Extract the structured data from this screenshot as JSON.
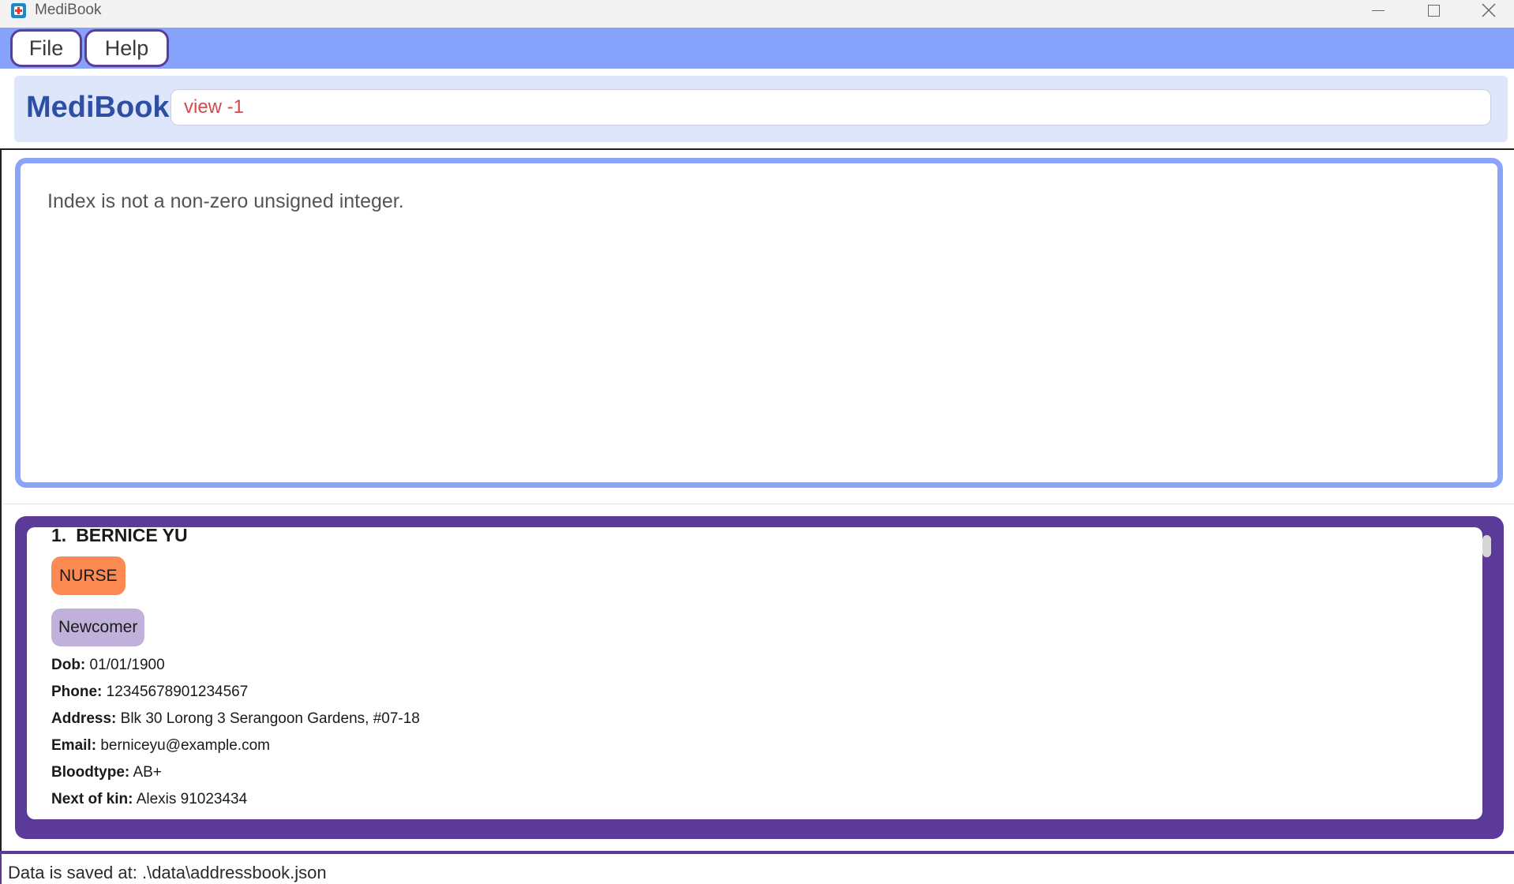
{
  "window": {
    "title": "MediBook",
    "icon": "medibook-app-icon",
    "controls": [
      "minimize-icon",
      "maximize-icon",
      "close-icon"
    ]
  },
  "menubar": {
    "file_label": "File",
    "help_label": "Help"
  },
  "command": {
    "brand": "MediBook",
    "input_value": "view -1"
  },
  "result": {
    "message": "Index is not a non-zero unsigned integer."
  },
  "person_list": {
    "items": [
      {
        "index": "1.",
        "name": "BERNICE YU",
        "role": "NURSE",
        "tag": "Newcomer",
        "dob_label": "Dob:",
        "dob": "01/01/1900",
        "phone_label": "Phone:",
        "phone": "12345678901234567",
        "address_label": "Address:",
        "address": "Blk 30 Lorong 3 Serangoon Gardens, #07-18",
        "email_label": "Email:",
        "email": "berniceyu@example.com",
        "bloodtype_label": "Bloodtype:",
        "bloodtype": "AB+",
        "kin_label": "Next of kin:",
        "kin": "Alexis 91023434"
      }
    ]
  },
  "statusbar": {
    "text": "Data is saved at: .\\data\\addressbook.json"
  },
  "colors": {
    "menubar": "#87a2fa",
    "accent_purple": "#5b3a9a",
    "result_border": "#8aa4f9",
    "brand": "#2e4fa3",
    "role_tag": "#fc8a52",
    "status_tag": "#c0b1db",
    "error_text": "#d24a4a"
  }
}
